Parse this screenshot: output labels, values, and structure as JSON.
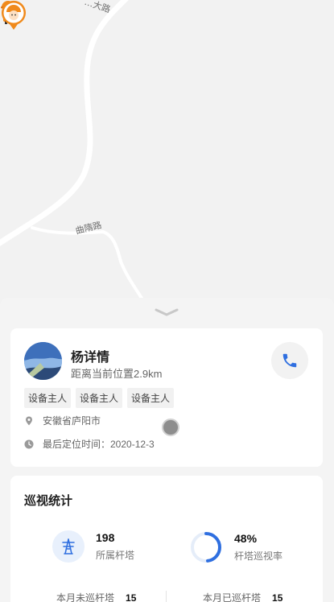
{
  "map": {
    "road_labels": [
      "…大路",
      "曲隋路"
    ]
  },
  "person": {
    "name": "杨详情",
    "distance": "距离当前位置2.9km",
    "tags": [
      "设备主人",
      "设备主人",
      "设备主人"
    ],
    "address": "安徽省庐阳市",
    "last_location": "最后定位时间：2020-12-3"
  },
  "stats": {
    "title": "巡视统计",
    "towers_count": "198",
    "towers_label": "所属杆塔",
    "patrol_rate": "48%",
    "patrol_rate_value": 0.48,
    "patrol_rate_label": "杆塔巡视率",
    "unpatrolled_label": "本月未巡杆塔",
    "unpatrolled_value": "15",
    "patrolled_label": "本月已巡杆塔",
    "patrolled_value": "15"
  },
  "colors": {
    "accent": "#2f6fe0",
    "worker_orange": "#f08a1c"
  },
  "icons": [
    "worker-avatar-icon",
    "chevron-down-icon",
    "phone-icon",
    "location-pin-icon",
    "clock-icon",
    "power-tower-icon"
  ]
}
